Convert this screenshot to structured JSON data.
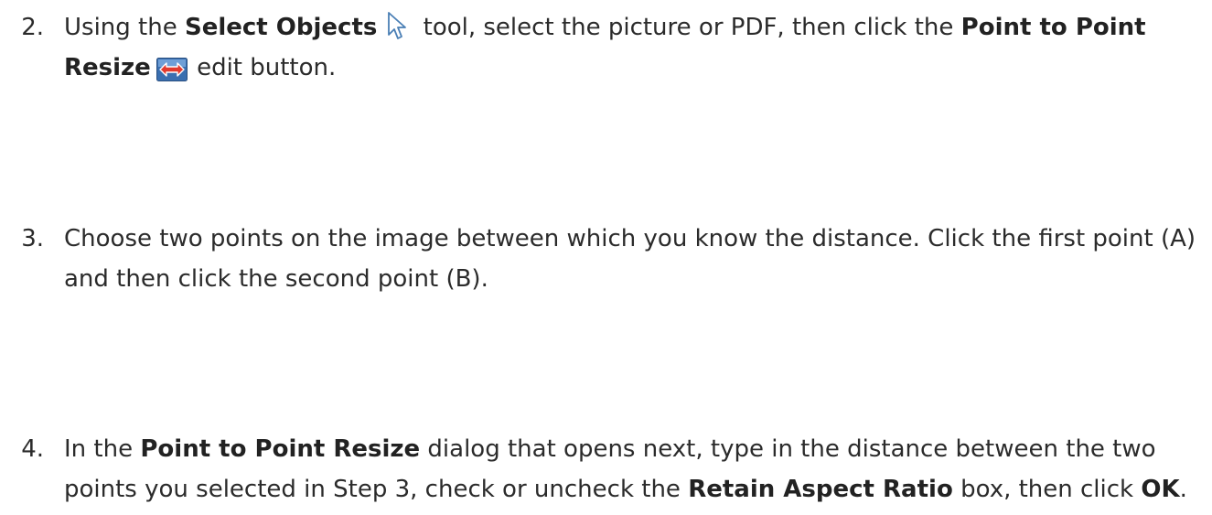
{
  "steps": [
    {
      "number": "2.",
      "t1": "Using the ",
      "b1": "Select Objects",
      "icon1": "select-objects-cursor-icon",
      "t2": " tool, select the picture or PDF, then click the ",
      "b2": "Point to Point Resize",
      "icon2": "point-to-point-resize-icon",
      "t3": " edit button."
    },
    {
      "number": "3.",
      "t1": "Choose two points on the image between which you know the distance. Click the first point (A) and then click the second point (B)."
    },
    {
      "number": "4.",
      "t1": "In the ",
      "b1": "Point to Point Resize",
      "t2": " dialog that opens next, type in the distance between the two points you selected in Step 3, check or uncheck the ",
      "b2": "Retain Aspect Ratio",
      "t3": " box, then click ",
      "b3": "OK",
      "t4": "."
    }
  ],
  "colors": {
    "text": "#2b2b2b",
    "cursor_outline": "#4a7fb5",
    "resize_bg": "#3a6fb0",
    "resize_arrow": "#e23b2e"
  }
}
